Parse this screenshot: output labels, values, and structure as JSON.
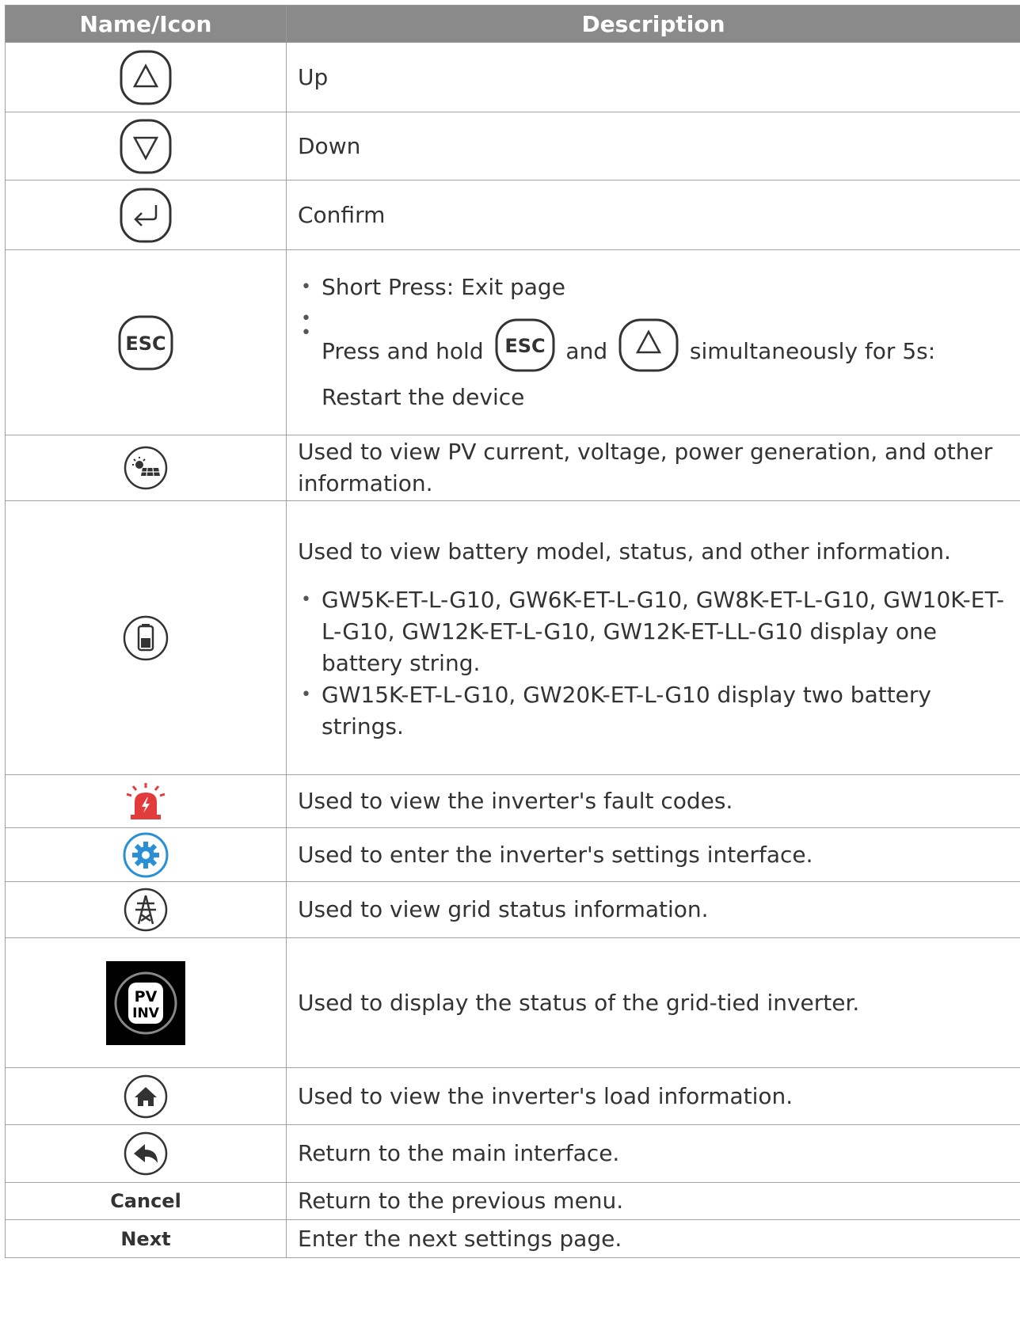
{
  "header": {
    "col1": "Name/Icon",
    "col2": "Description"
  },
  "rows": {
    "up": {
      "icon": "up-arrow-button-icon",
      "desc": "Up"
    },
    "down": {
      "icon": "down-arrow-button-icon",
      "desc": "Down"
    },
    "confirm": {
      "icon": "enter-button-icon",
      "desc": "Confirm"
    },
    "esc": {
      "icon": "esc-button-icon",
      "icon_text": "ESC",
      "bullet1": "Short Press: Exit page",
      "bullet2_a": "Press and hold",
      "bullet2_b": "and",
      "bullet2_c": "simultaneously for 5s:",
      "bullet2_d": "Restart the device"
    },
    "pv": {
      "icon": "solar-panel-icon",
      "desc": "Used to view PV current, voltage, power generation, and other information."
    },
    "battery": {
      "icon": "battery-icon",
      "desc": "Used to view battery model, status, and other information.",
      "bullet1": "GW5K-ET-L-G10, GW6K-ET-L-G10, GW8K-ET-L-G10, GW10K-ET-L-G10, GW12K-ET-L-G10, GW12K-ET-LL-G10 display one battery string.",
      "bullet2": "GW15K-ET-L-G10, GW20K-ET-L-G10 display two battery strings."
    },
    "fault": {
      "icon": "alarm-siren-icon",
      "desc": "Used to view the inverter's fault codes."
    },
    "settings": {
      "icon": "gear-icon",
      "desc": "Used to enter the inverter's settings interface."
    },
    "grid": {
      "icon": "power-tower-icon",
      "desc": "Used to view grid status information."
    },
    "pvinv": {
      "icon": "pv-inverter-icon",
      "icon_text_top": "PV",
      "icon_text_bottom": "INV",
      "desc": "Used to display the status of the grid-tied inverter."
    },
    "load": {
      "icon": "home-icon",
      "desc": "Used to view the inverter's load information."
    },
    "back": {
      "icon": "return-arrow-icon",
      "desc": "Return to the main interface."
    },
    "cancel": {
      "label": "Cancel",
      "desc": "Return to the previous menu."
    },
    "next": {
      "label": "Next",
      "desc": "Enter the next settings page."
    }
  },
  "colors": {
    "header_bg": "#8a8a8a",
    "fault_red": "#e23b3b",
    "settings_blue": "#2b8fd6"
  }
}
